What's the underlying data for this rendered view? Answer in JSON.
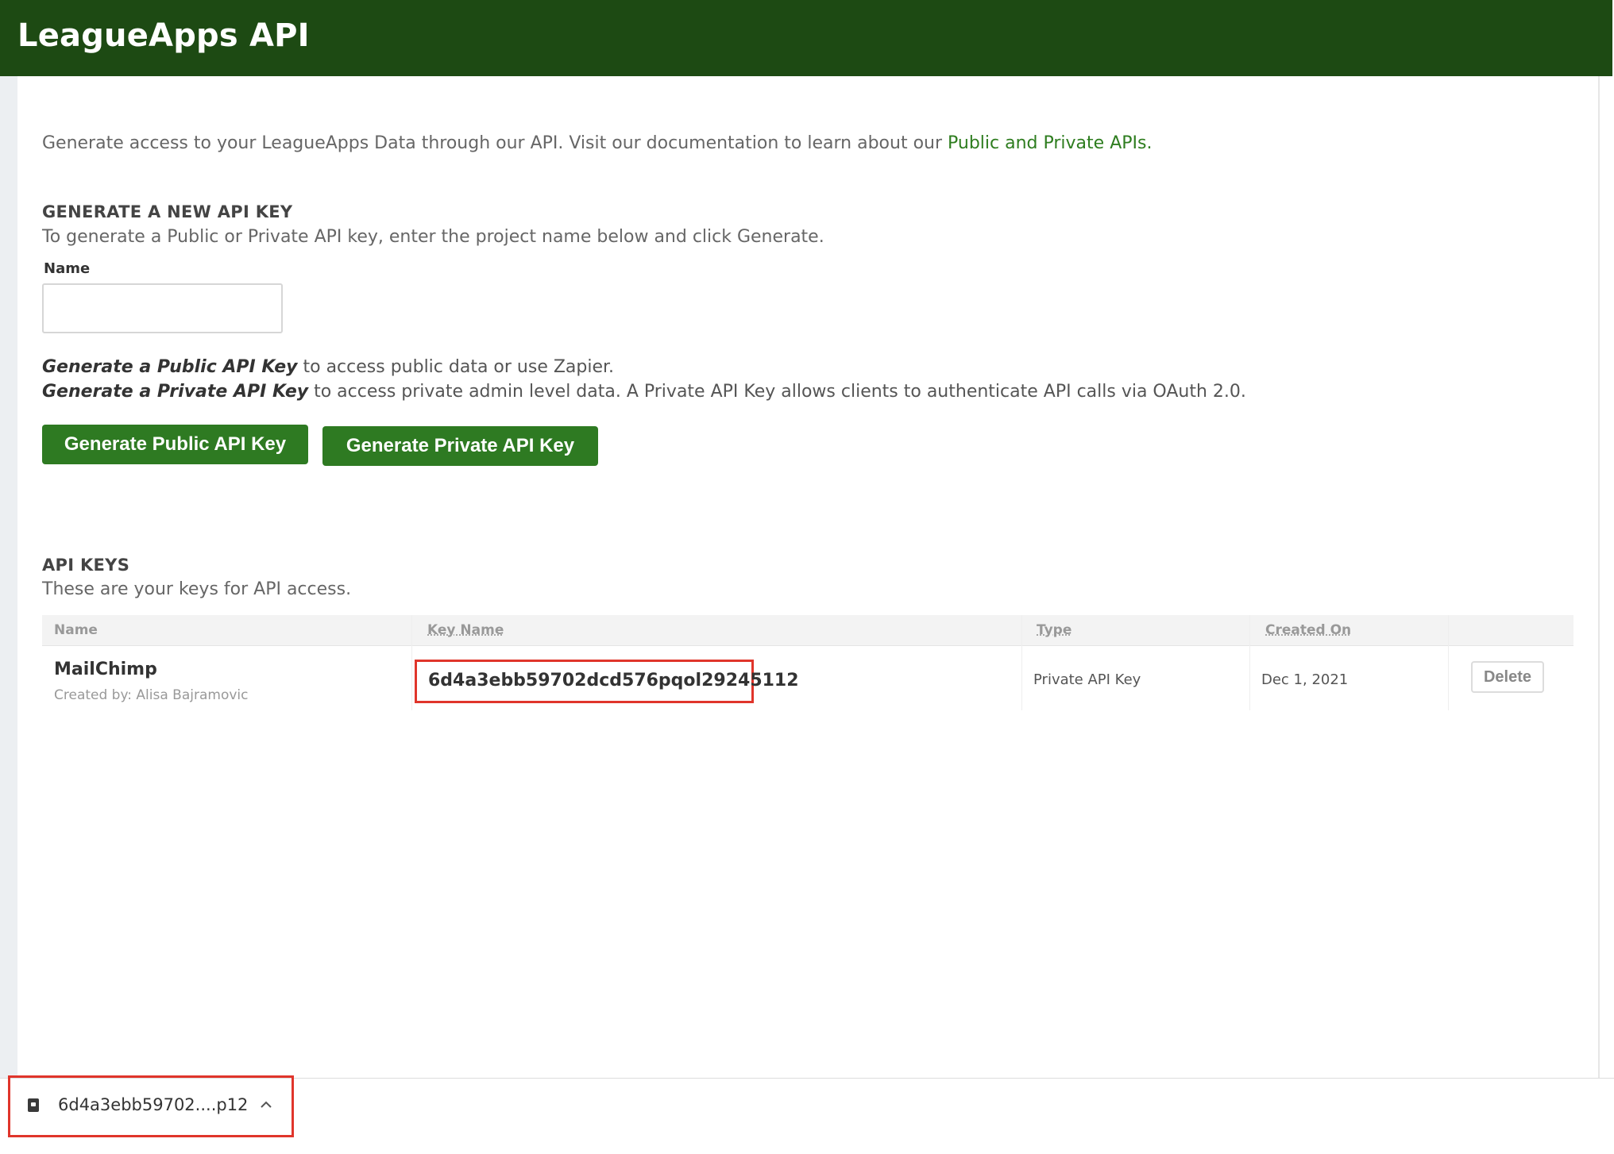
{
  "header": {
    "title": "LeagueApps API"
  },
  "intro": {
    "text": "Generate access to your LeagueApps Data through our API. Visit our documentation to learn about our ",
    "link_text": "Public and Private APIs."
  },
  "generate_section": {
    "title": "GENERATE A NEW API KEY",
    "description": "To generate a Public or Private API key, enter the project name below and click Generate.",
    "name_label": "Name",
    "name_value": "",
    "public_emphasis": "Generate a Public API Key",
    "public_rest": " to access public data or use Zapier.",
    "private_emphasis": "Generate a Private API Key",
    "private_rest": " to access private admin level data. A Private API Key allows clients to authenticate API calls via OAuth 2.0.",
    "public_button": "Generate Public API Key",
    "private_button": "Generate Private API Key"
  },
  "keys_section": {
    "title": "API KEYS",
    "description": "These are your keys for API access.",
    "columns": [
      "Name",
      "Key Name",
      "Type",
      "Created On"
    ],
    "rows": [
      {
        "name": "MailChimp",
        "created_by": "Created by: Alisa Bajramovic",
        "key_name": "6d4a3ebb59702dcd576pqol29245112",
        "type": "Private API Key",
        "created_on": "Dec 1, 2021",
        "delete_label": "Delete"
      }
    ]
  },
  "download_bar": {
    "file_name": "6d4a3ebb59702....p12",
    "chevron": "^"
  },
  "colors": {
    "header_bg": "#1d4a13",
    "button_bg": "#2e7a22",
    "link": "#2e7d1f",
    "highlight": "#e0352b"
  }
}
